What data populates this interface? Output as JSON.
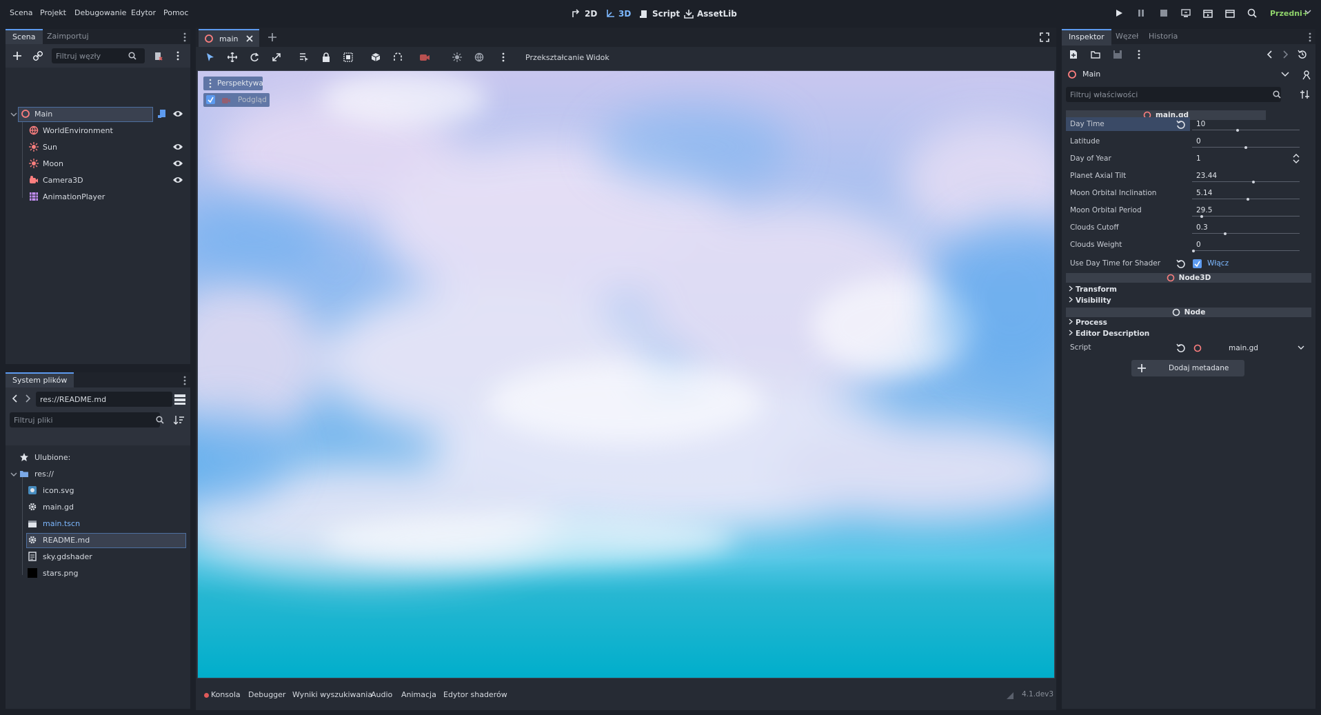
{
  "menu": {
    "items": [
      "Scena",
      "Projekt",
      "Debugowanie",
      "Edytor",
      "Pomoc"
    ]
  },
  "workspaces": {
    "items": [
      {
        "label": "2D",
        "icon": "2d-icon"
      },
      {
        "label": "3D",
        "icon": "3d-icon"
      },
      {
        "label": "Script",
        "icon": "script-icon"
      },
      {
        "label": "AssetLib",
        "icon": "assetlib-icon"
      }
    ],
    "active": "3D"
  },
  "renderer": {
    "label": "Przedni+"
  },
  "scene_dock": {
    "tabs": [
      "Scena",
      "Zaimportuj"
    ],
    "filter_placeholder": "Filtruj węzły",
    "nodes": [
      {
        "label": "Main",
        "icon": "node3d-icon",
        "selected": true,
        "visible_toggle": true
      },
      {
        "label": "WorldEnvironment",
        "icon": "world-environment-icon"
      },
      {
        "label": "Sun",
        "icon": "light-icon",
        "visible_toggle": true
      },
      {
        "label": "Moon",
        "icon": "light-icon",
        "visible_toggle": true
      },
      {
        "label": "Camera3D",
        "icon": "camera-icon",
        "visible_toggle": true
      },
      {
        "label": "AnimationPlayer",
        "icon": "animation-player-icon"
      }
    ]
  },
  "filesystem_dock": {
    "tab": "System plików",
    "path": "res://README.md",
    "filter_placeholder": "Filtruj pliki",
    "favorites_label": "Ulubione:",
    "root_label": "res://",
    "files": [
      {
        "label": "icon.svg",
        "icon": "image-icon"
      },
      {
        "label": "main.gd",
        "icon": "gear-icon"
      },
      {
        "label": "main.tscn",
        "icon": "scene-icon",
        "highlight": true
      },
      {
        "label": "README.md",
        "icon": "text-file-icon",
        "selected": true
      },
      {
        "label": "sky.gdshader",
        "icon": "shader-icon"
      },
      {
        "label": "stars.png",
        "icon": "image-icon"
      }
    ]
  },
  "editor": {
    "tab_label": "main",
    "toolbar": {
      "transform_label": "Przekształcanie",
      "view_label": "Widok"
    },
    "viewport": {
      "perspective_label": "Perspektywa",
      "preview_label": "Podgląd"
    }
  },
  "bottom_panel": {
    "tabs": [
      "Konsola",
      "Debugger",
      "Wyniki wyszukiwania",
      "Audio",
      "Animacja",
      "Edytor shaderów"
    ],
    "version": "4.1.dev3"
  },
  "inspector": {
    "tabs": [
      "Inspektor",
      "Węzeł",
      "Historia"
    ],
    "object_label": "Main",
    "filter_placeholder": "Filtruj właściwości",
    "script_section": "main.gd",
    "properties": [
      {
        "name": "Day Time",
        "value": "10",
        "fill": 0.42,
        "slider": true,
        "selected": true,
        "revert": true
      },
      {
        "name": "Latitude",
        "value": "0",
        "fill": 0.5,
        "slider": true
      },
      {
        "name": "Day of Year",
        "value": "1",
        "spin": true
      },
      {
        "name": "Planet Axial Tilt",
        "value": "23.44",
        "fill": 0.57,
        "slider": true
      },
      {
        "name": "Moon Orbital Inclination",
        "value": "5.14",
        "fill": 0.52,
        "slider": true
      },
      {
        "name": "Moon Orbital Period",
        "value": "29.5",
        "fill": 0.08,
        "slider": true
      },
      {
        "name": "Clouds Cutoff",
        "value": "0.3",
        "fill": 0.3,
        "slider": true
      },
      {
        "name": "Clouds Weight",
        "value": "0",
        "fill": 0.0,
        "slider": true
      }
    ],
    "shader_toggle": {
      "name": "Use Day Time for Shader",
      "value": "Włącz"
    },
    "node3d_section": "Node3D",
    "node3d_categories": [
      "Transform",
      "Visibility"
    ],
    "node_section": "Node",
    "node_categories": [
      "Process",
      "Editor Description"
    ],
    "script_row": {
      "name": "Script",
      "value": "main.gd"
    },
    "add_metadata_label": "Dodaj metadane"
  },
  "colors": {
    "accent": "#5d9bf0",
    "panel": "#262b34",
    "background": "#1c2028"
  }
}
